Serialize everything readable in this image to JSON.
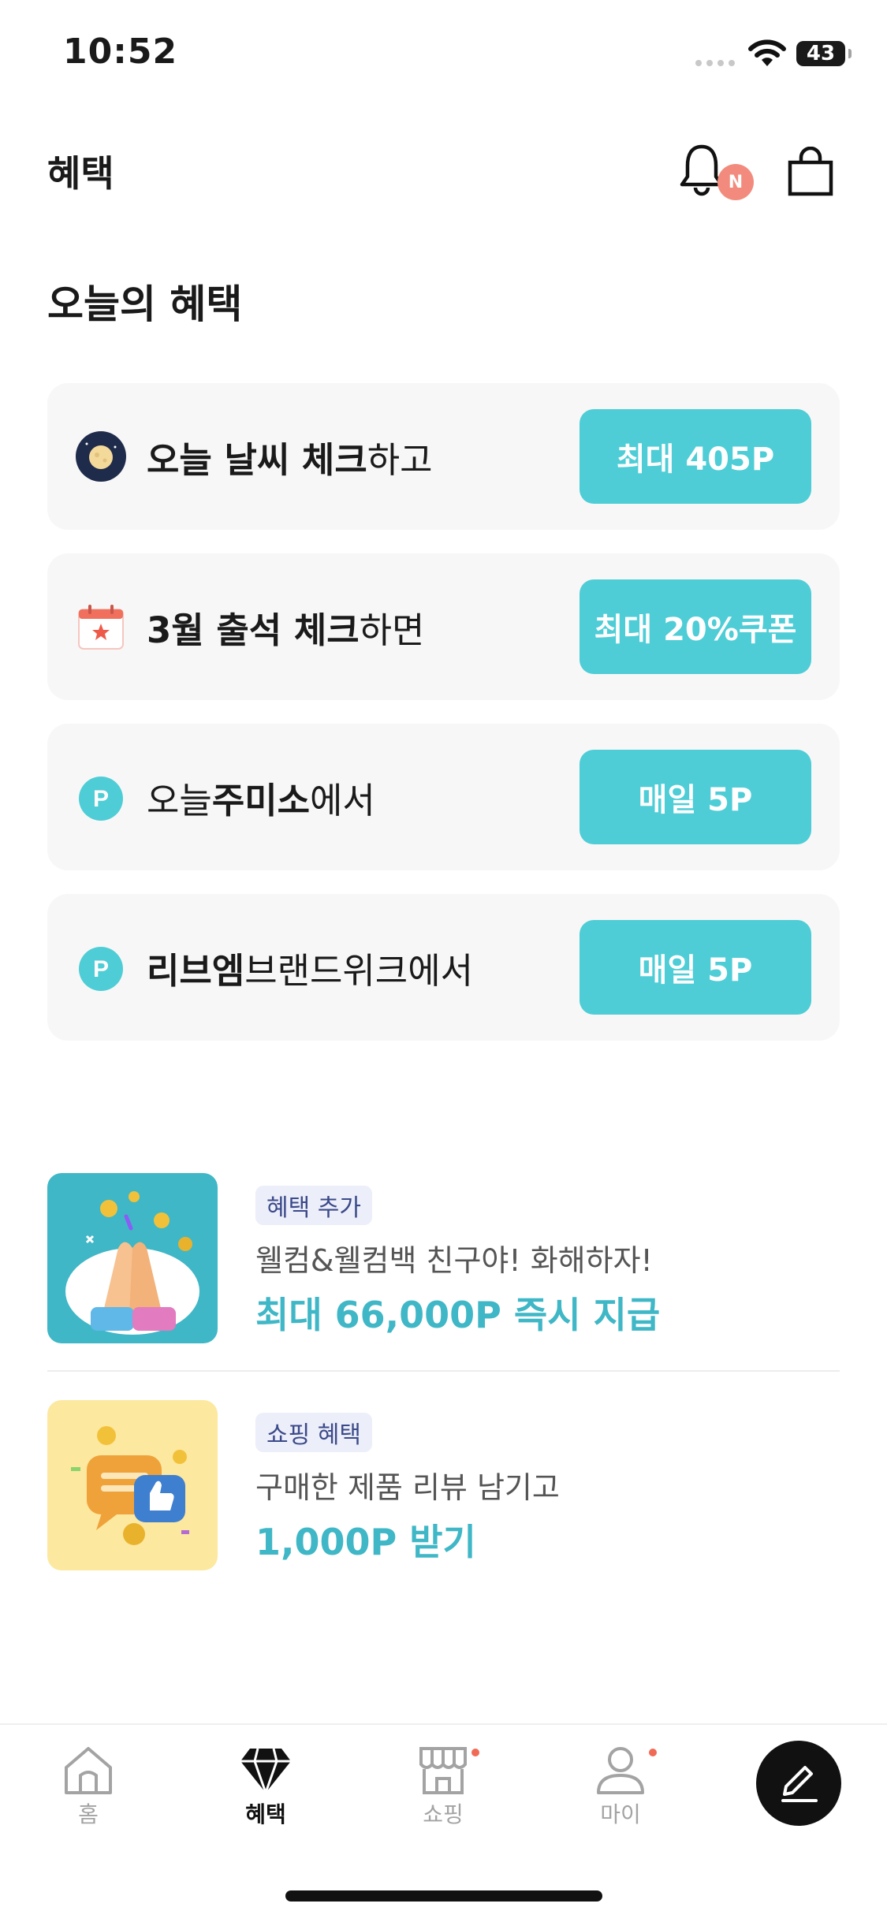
{
  "status_bar": {
    "time": "10:52",
    "battery": "43"
  },
  "header": {
    "title": "혜택",
    "notification_badge": "N"
  },
  "section": {
    "title": "오늘의 혜택"
  },
  "benefits": [
    {
      "bold": "오늘 날씨 체크",
      "regular": "하고",
      "button": "최대 405P",
      "icon": "moon-icon"
    },
    {
      "bold": "3월 출석 체크",
      "regular": "하면",
      "button": "최대 20%쿠폰",
      "icon": "calendar-icon"
    },
    {
      "pre": "오늘 ",
      "bold": "주미소",
      "regular": "에서",
      "button": "매일 5P",
      "icon": "point-icon"
    },
    {
      "bold": "리브엠",
      "regular": " 브랜드위크에서",
      "button": "매일 5P",
      "icon": "point-icon"
    }
  ],
  "promos": [
    {
      "tag": "혜택 추가",
      "desc": "웰컴&웰컴백 친구야! 화해하자!",
      "highlight": "최대 66,000P 즉시 지급",
      "thumb_color": "#3fb7c6",
      "icon": "clapping-hands-icon"
    },
    {
      "tag": "쇼핑 혜택",
      "desc": "구매한 제품 리뷰 남기고",
      "highlight": "1,000P 받기",
      "thumb_color": "#fde8a0",
      "icon": "review-chat-icon"
    }
  ],
  "tabs": [
    {
      "label": "홈",
      "icon": "home-icon",
      "active": false
    },
    {
      "label": "혜택",
      "icon": "diamond-icon",
      "active": true
    },
    {
      "label": "쇼핑",
      "icon": "store-icon",
      "active": false
    },
    {
      "label": "마이",
      "icon": "person-icon",
      "active": false
    }
  ],
  "colors": {
    "accent": "#4ecdd6",
    "highlight": "#3fb7c6",
    "badge": "#f28b7d"
  }
}
